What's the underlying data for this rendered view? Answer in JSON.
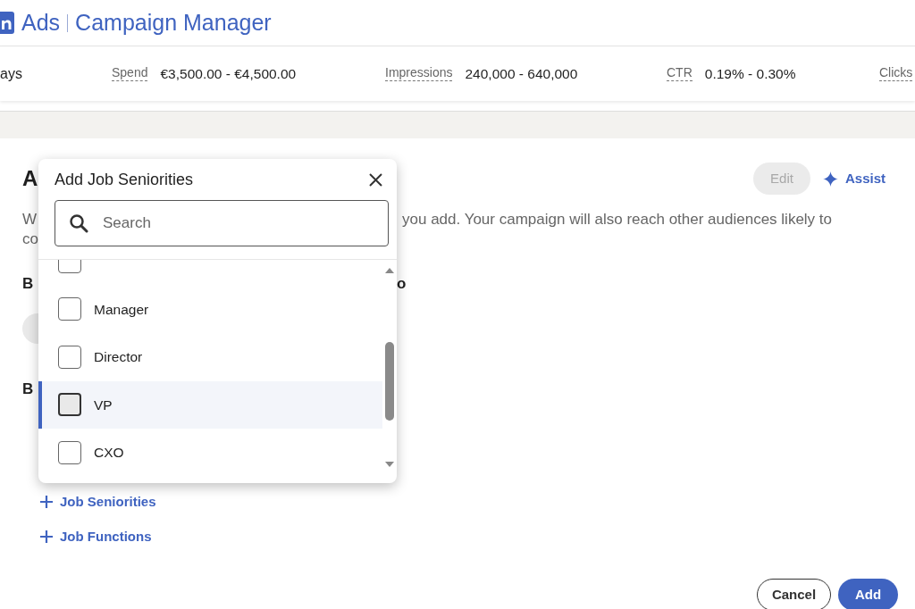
{
  "header": {
    "product": "Ads",
    "title": "Campaign Manager"
  },
  "forecast": {
    "lead": "ays",
    "metrics": [
      {
        "label": "Spend",
        "value": "€3,500.00 - €4,500.00"
      },
      {
        "label": "Impressions",
        "value": "240,000 - 640,000"
      },
      {
        "label": "CTR",
        "value": "0.19% - 0.30%"
      },
      {
        "label": "Clicks"
      }
    ]
  },
  "audience": {
    "heading": "A",
    "edit_button": {
      "label": "Edit",
      "disabled": true
    },
    "assist_button": "Assist",
    "description": [
      {
        "left": "W",
        "right": "you add. Your campaign will also reach other audiences likely to"
      },
      {
        "left": "co"
      }
    ],
    "sections": [
      {
        "left": "B",
        "right": "o"
      },
      {
        "left": "B"
      }
    ],
    "add_links": [
      "Job Seniorities",
      "Job Functions"
    ]
  },
  "dialog": {
    "title": "Add Job Seniorities",
    "search": {
      "placeholder": "Search"
    },
    "options": [
      {
        "checked": false,
        "selected": false
      },
      {
        "label": "Manager",
        "checked": false,
        "selected": false
      },
      {
        "label": "Director",
        "checked": false,
        "selected": false
      },
      {
        "label": "VP",
        "checked": false,
        "selected": true
      },
      {
        "label": "CXO",
        "checked": false,
        "selected": false
      }
    ]
  },
  "footer": {
    "buttons": [
      {
        "label": "Cancel",
        "kind": "secondary"
      },
      {
        "label": "Add",
        "kind": "primary"
      }
    ]
  }
}
